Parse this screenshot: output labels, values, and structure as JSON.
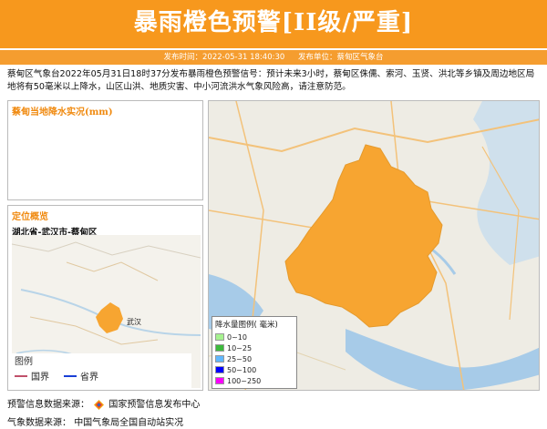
{
  "header": {
    "title": "暴雨橙色预警[II级/严重]",
    "publish_time_label": "发布时间：2022-05-31 18:40:30",
    "publish_unit_label": "发布单位：蔡甸区气象台"
  },
  "description": "蔡甸区气象台2022年05月31日18时37分发布暴雨橙色预警信号：预计未来3小时，蔡甸区侏儒、索河、玉贤、洪北等乡镇及周边地区局地将有50毫米以上降水，山区山洪、地质灾害、中小河流洪水气象风险高，请注意防范。",
  "rain_panel": {
    "title": "蔡甸当地降水实况(mm)"
  },
  "location_panel": {
    "title": "定位概览",
    "region": "湖北省-武汉市-蔡甸区",
    "map_label": "武汉",
    "legend_title": "图例",
    "legend_items": [
      {
        "label": "国界",
        "color": "#c0506a"
      },
      {
        "label": "省界",
        "color": "#1a3fd6"
      }
    ]
  },
  "main_map": {
    "region_color": "#f7a531",
    "legend_title": "降水量图例( 毫米)",
    "legend_items": [
      {
        "label": "0~10",
        "color": "#a6f28f"
      },
      {
        "label": "10~25",
        "color": "#3dba3d"
      },
      {
        "label": "25~50",
        "color": "#61b8ff"
      },
      {
        "label": "50~100",
        "color": "#0000fe"
      },
      {
        "label": "100~250",
        "color": "#fa00fa"
      }
    ]
  },
  "sources": {
    "warning_label": "预警信息数据来源：",
    "warning_value": "国家预警信息发布中心",
    "weather_label": "气象数据来源：",
    "weather_value": "中国气象局全国自动站实况"
  }
}
